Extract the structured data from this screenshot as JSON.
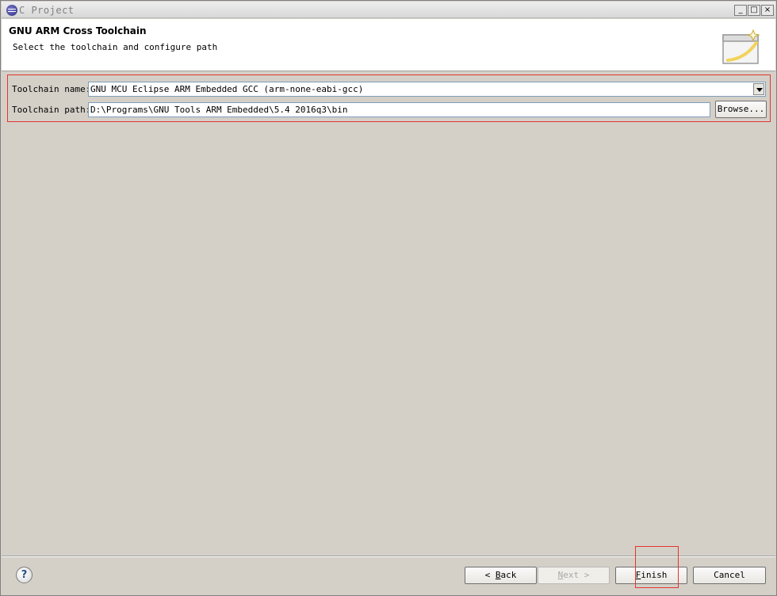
{
  "window": {
    "title": "C Project",
    "controls": [
      "_",
      "□",
      "×"
    ]
  },
  "header": {
    "title": "GNU ARM Cross Toolchain",
    "description": "Select the toolchain and configure path"
  },
  "form": {
    "toolchain_name_label": "Toolchain name:",
    "toolchain_name_value": "GNU MCU Eclipse ARM Embedded GCC (arm-none-eabi-gcc)",
    "toolchain_path_label": "Toolchain path:",
    "toolchain_path_value": "D:\\Programs\\GNU Tools ARM Embedded\\5.4 2016q3\\bin",
    "browse_label": "Browse..."
  },
  "buttons": {
    "help": "?",
    "back": "< Back",
    "back_mnemonic": "B",
    "back_rest": "ack",
    "next_prefix": "",
    "next_mnemonic": "N",
    "next_rest": "ext >",
    "finish_mnemonic": "F",
    "finish_rest": "inish",
    "cancel": "Cancel"
  },
  "colors": {
    "highlight": "#e3342f",
    "dialog_bg": "#d4d0c8"
  }
}
